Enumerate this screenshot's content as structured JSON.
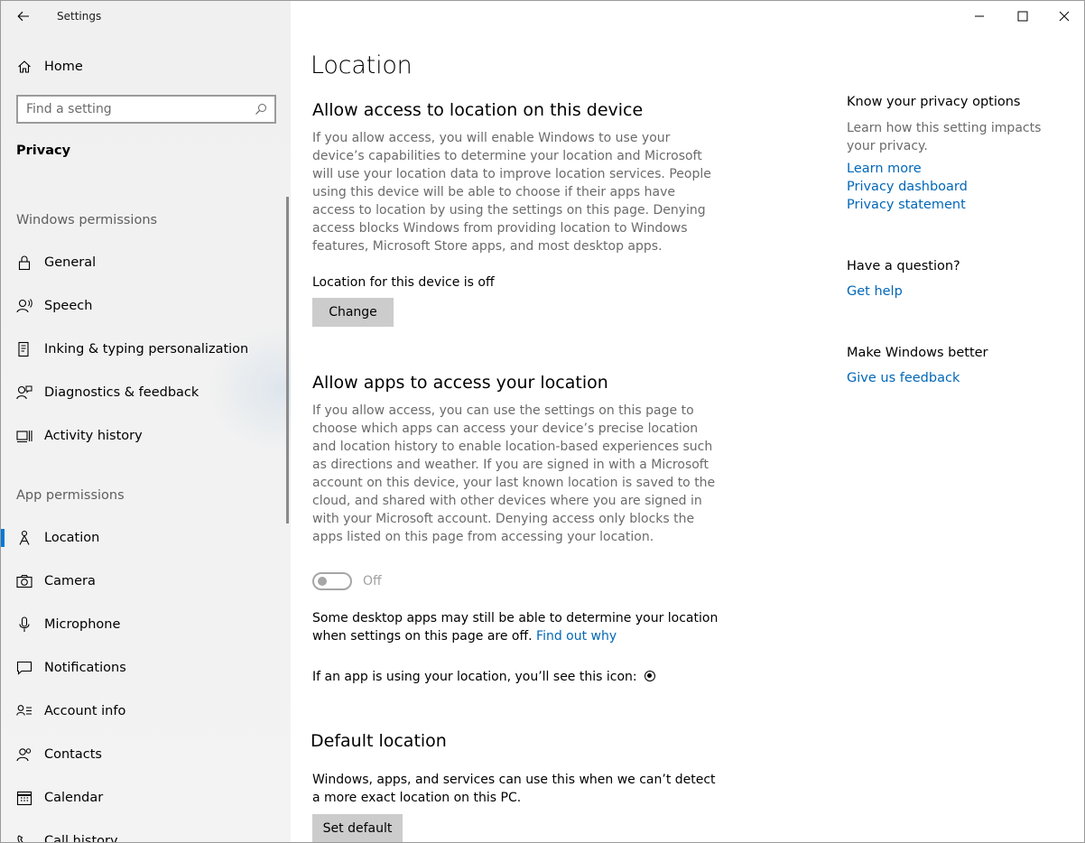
{
  "window": {
    "app_title": "Settings"
  },
  "sidebar": {
    "home_label": "Home",
    "search_placeholder": "Find a setting",
    "category": "Privacy",
    "windows_permissions_label": "Windows permissions",
    "app_permissions_label": "App permissions",
    "windows_items": [
      {
        "label": "General",
        "icon": "lock-icon"
      },
      {
        "label": "Speech",
        "icon": "speech-icon"
      },
      {
        "label": "Inking & typing personalization",
        "icon": "inking-icon"
      },
      {
        "label": "Diagnostics & feedback",
        "icon": "diagnostics-icon"
      },
      {
        "label": "Activity history",
        "icon": "activity-history-icon"
      }
    ],
    "app_items": [
      {
        "label": "Location",
        "icon": "location-icon",
        "active": true
      },
      {
        "label": "Camera",
        "icon": "camera-icon"
      },
      {
        "label": "Microphone",
        "icon": "microphone-icon"
      },
      {
        "label": "Notifications",
        "icon": "notifications-icon"
      },
      {
        "label": "Account info",
        "icon": "account-info-icon"
      },
      {
        "label": "Contacts",
        "icon": "contacts-icon"
      },
      {
        "label": "Calendar",
        "icon": "calendar-icon"
      },
      {
        "label": "Call history",
        "icon": "call-history-icon"
      }
    ]
  },
  "main": {
    "title": "Location",
    "device_section": {
      "heading": "Allow access to location on this device",
      "description": "If you allow access, you will enable Windows to use your device’s capabilities to determine your location and Microsoft will use your location data to improve location services. People using this device will be able to choose if their apps have access to location by using the settings on this page. Denying access blocks Windows from providing location to Windows features, Microsoft Store apps, and most desktop apps.",
      "status": "Location for this device is off",
      "change_button": "Change"
    },
    "apps_section": {
      "heading": "Allow apps to access your location",
      "description": "If you allow access, you can use the settings on this page to choose which apps can access your device’s precise location and location history to enable location-based experiences such as directions and weather. If you are signed in with a Microsoft account on this device, your last known location is saved to the cloud, and shared with other devices where you are signed in with your Microsoft account. Denying access only blocks the apps listed on this page from accessing your location.",
      "toggle_state": "Off",
      "desktop_note": "Some desktop apps may still be able to determine your location when settings on this page are off.",
      "find_out_why": "Find out why",
      "icon_note": "If an app is using your location, you’ll see this icon:"
    },
    "default_section": {
      "heading": "Default location",
      "description": "Windows, apps, and services can use this when we can’t detect a more exact location on this PC.",
      "set_default_button": "Set default"
    }
  },
  "right_column": {
    "privacy_heading": "Know your privacy options",
    "privacy_text": "Learn how this setting impacts your privacy.",
    "links": [
      "Learn more",
      "Privacy dashboard",
      "Privacy statement"
    ],
    "question_heading": "Have a question?",
    "get_help": "Get help",
    "better_heading": "Make Windows better",
    "feedback": "Give us feedback"
  },
  "colors": {
    "accent": "#0078d7",
    "link": "#0067b8",
    "sidebar_bg": "#f2f2f2",
    "button_bg": "#cccccc"
  }
}
